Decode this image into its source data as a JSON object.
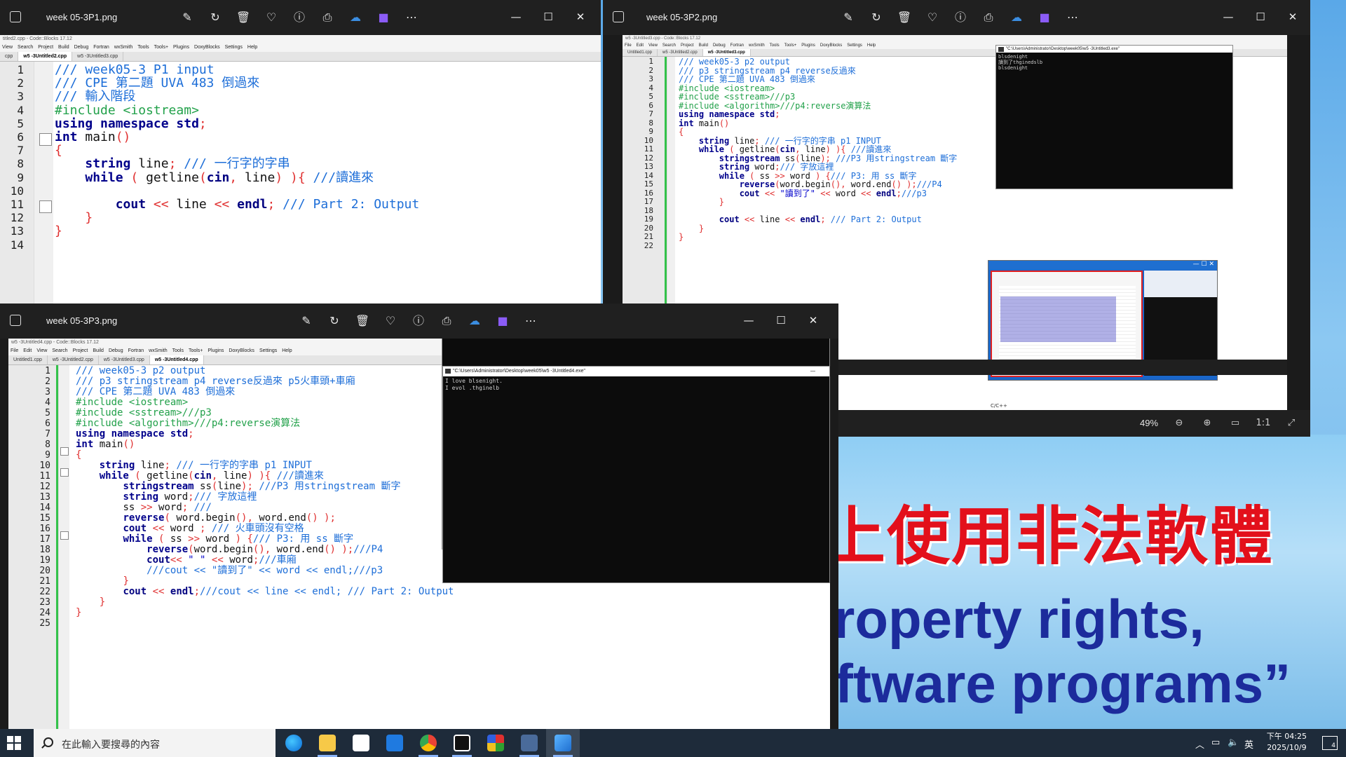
{
  "background_slide": {
    "red_text": "上使用非法軟體",
    "blue_line1": "roperty rights,",
    "blue_line2": "ftware programs”"
  },
  "viewer_tools": [
    "edit-icon",
    "rotate-icon",
    "delete-icon",
    "favorite-icon",
    "info-icon",
    "print-icon",
    "onedrive-icon",
    "clipchamp-icon",
    "more-icon"
  ],
  "windows": {
    "p1": {
      "title": "week 05-3P1.png",
      "cb_title": "titled2.cpp - Code::Blocks 17.12",
      "menu": [
        "View",
        "Search",
        "Project",
        "Build",
        "Debug",
        "Fortran",
        "wxSmith",
        "Tools",
        "Tools+",
        "Plugins",
        "DoxyBlocks",
        "Settings",
        "Help"
      ],
      "tabs": [
        "cpp",
        "w5 -3Untitled2.cpp",
        "w5 -3Untitled3.cpp"
      ],
      "active_tab": 1,
      "line_numbers": [
        "1",
        "2",
        "3",
        "4",
        "5",
        "6",
        "7",
        "8",
        "9",
        "10",
        "11",
        "12",
        "13",
        "14"
      ]
    },
    "p2": {
      "title": "week 05-3P2.png",
      "cb_title": "w5 -3Untitled3.cpp - Code::Blocks 17.12",
      "menu": [
        "File",
        "Edit",
        "View",
        "Search",
        "Project",
        "Build",
        "Debug",
        "Fortran",
        "wxSmith",
        "Tools",
        "Tools+",
        "Plugins",
        "DoxyBlocks",
        "Settings",
        "Help"
      ],
      "tabs": [
        "Untitled1.cpp",
        "w5 -3Untitled2.cpp",
        "w5 -3Untitled3.cpp"
      ],
      "active_tab": 2,
      "line_numbers": [
        "1",
        "2",
        "3",
        "4",
        "5",
        "6",
        "7",
        "8",
        "9",
        "10",
        "11",
        "12",
        "13",
        "14",
        "15",
        "16",
        "17",
        "18",
        "19",
        "20",
        "21",
        "22"
      ],
      "console_title": "\"C:\\Users\\Administrator\\Desktop\\week05\\w5 -3Untitled3.exe\"",
      "console_lines": [
        "blsdenight",
        "讀到了thginedslb",
        "blsdenight"
      ],
      "zoom": "49%",
      "status_lang": "C/C++"
    },
    "p3": {
      "title": "week 05-3P3.png",
      "cb_title": "w5 -3Untitled4.cpp - Code::Blocks 17.12",
      "menu": [
        "File",
        "Edit",
        "View",
        "Search",
        "Project",
        "Build",
        "Debug",
        "Fortran",
        "wxSmith",
        "Tools",
        "Tools+",
        "Plugins",
        "DoxyBlocks",
        "Settings",
        "Help"
      ],
      "tabs": [
        "Untitled1.cpp",
        "w5 -3Untitled2.cpp",
        "w5 -3Untitled3.cpp",
        "w5 -3Untitled4.cpp"
      ],
      "active_tab": 3,
      "line_numbers": [
        "1",
        "2",
        "3",
        "4",
        "5",
        "6",
        "7",
        "8",
        "9",
        "10",
        "11",
        "12",
        "13",
        "14",
        "15",
        "16",
        "17",
        "18",
        "19",
        "20",
        "21",
        "22",
        "23",
        "24",
        "25"
      ],
      "console_title": "\"C:\\Users\\Administrator\\Desktop\\week05\\w5 -3Untitled4.exe\"",
      "console_lines": [
        "I love blsenight.",
        "I evol .thginelb"
      ]
    }
  },
  "taskbar": {
    "search_placeholder": "在此輸入要搜尋的內容",
    "tray_ime": "英",
    "time": "下午 04:25",
    "date": "2025/10/9",
    "notifications": "4",
    "apps": [
      "edge",
      "file-explorer",
      "store",
      "mail",
      "chrome",
      "codeblocks",
      "red-app",
      "terminal",
      "photos"
    ]
  },
  "colors": {
    "comment": "#1d6ed8",
    "keyword": "#00008b",
    "preprocessor": "#22a14a",
    "symbol": "#e03030",
    "slide_red": "#e3101b",
    "slide_blue": "#1c2b9c"
  }
}
